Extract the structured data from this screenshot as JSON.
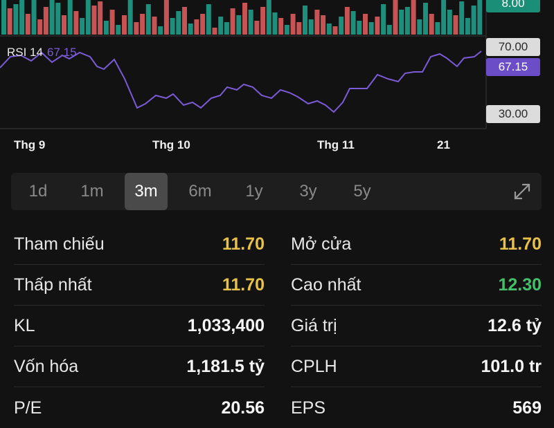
{
  "volume_bars": {
    "colors": {
      "up": "#1f8f7d",
      "down": "#c65454"
    },
    "label": "8.00"
  },
  "rsi": {
    "name": "RSI 14",
    "value": "67.15",
    "upper_level": "70.00",
    "lower_level": "30.00",
    "line_color": "#7a5cd6"
  },
  "x_axis": {
    "labels": [
      "Thg 9",
      "Thg 10",
      "Thg 11",
      "21"
    ]
  },
  "timeframes": {
    "options": [
      "1d",
      "1m",
      "3m",
      "6m",
      "1y",
      "3y",
      "5y"
    ],
    "selected": "3m"
  },
  "stats": {
    "reference": {
      "label": "Tham chiếu",
      "value": "11.70"
    },
    "open": {
      "label": "Mở cửa",
      "value": "11.70"
    },
    "low": {
      "label": "Thấp nhất",
      "value": "11.70"
    },
    "high": {
      "label": "Cao nhất",
      "value": "12.30"
    },
    "volume": {
      "label": "KL",
      "value": "1,033,400"
    },
    "turnover": {
      "label": "Giá trị",
      "value": "12.6 tỷ"
    },
    "market_cap": {
      "label": "Vốn hóa",
      "value": "1,181.5 tỷ"
    },
    "shares": {
      "label": "CPLH",
      "value": "101.0 tr"
    },
    "pe": {
      "label": "P/E",
      "value": "20.56"
    },
    "eps": {
      "label": "EPS",
      "value": "569"
    }
  }
}
